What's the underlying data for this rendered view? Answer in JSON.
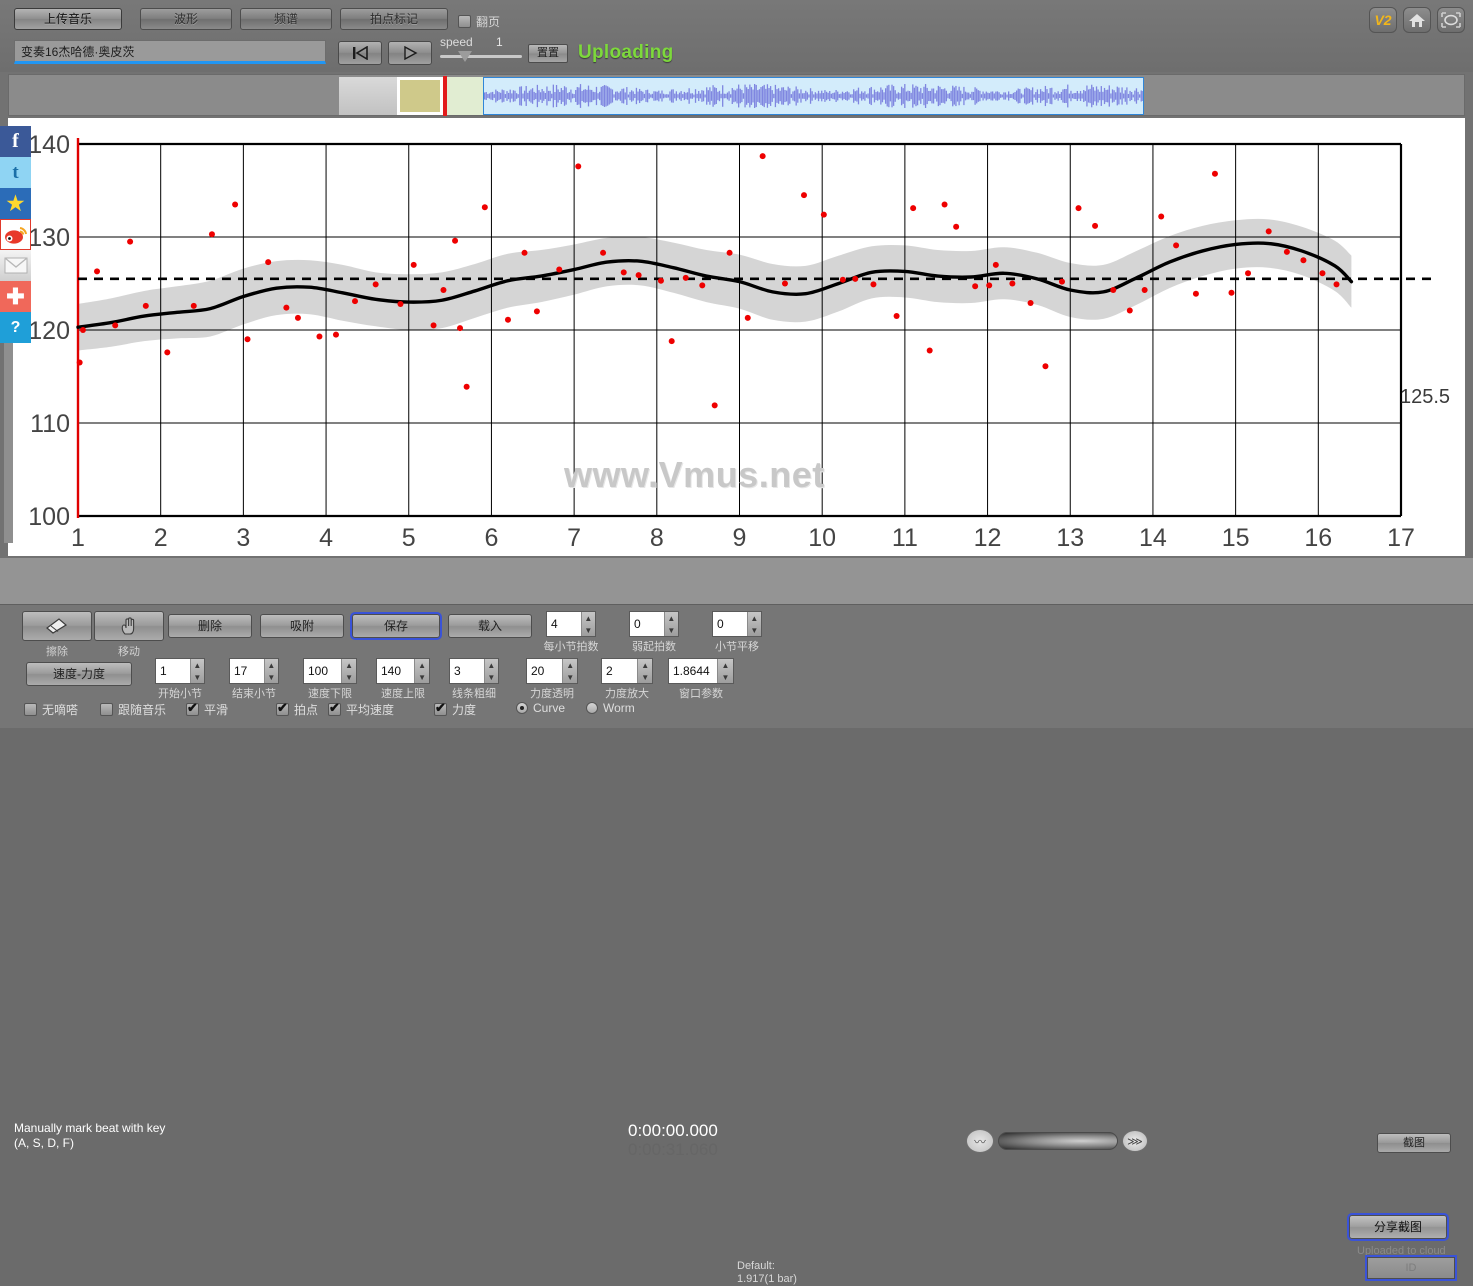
{
  "topbar": {
    "tabs": [
      {
        "label": "上传音乐",
        "active": true
      },
      {
        "label": "波形",
        "active": false
      },
      {
        "label": "频谱",
        "active": false
      },
      {
        "label": "拍点标记",
        "active": false
      }
    ],
    "page_turn_checkbox": {
      "label": "翻页",
      "checked": false
    },
    "title_field": {
      "value": "变奏16杰哈德·奥皮茨",
      "placeholder": ""
    },
    "prev_icon": "skip-to-start-icon",
    "play_icon": "play-icon",
    "speed_label": "speed",
    "speed_value": "1",
    "reset_label": "置置",
    "status": "Uploading",
    "right_icons": [
      {
        "name": "v2-badge",
        "label": "V2"
      },
      {
        "name": "home-icon",
        "label": "⌂"
      },
      {
        "name": "resize-icon",
        "label": "⛶"
      }
    ]
  },
  "social_rail": [
    {
      "name": "facebook-icon",
      "glyph": "f"
    },
    {
      "name": "twitter-icon",
      "glyph": "t"
    },
    {
      "name": "qzone-icon",
      "glyph": "★"
    },
    {
      "name": "weibo-icon",
      "glyph": "❝"
    },
    {
      "name": "email-icon",
      "glyph": "✉"
    },
    {
      "name": "more-share-icon",
      "glyph": "✚"
    },
    {
      "name": "help-icon",
      "glyph": "?"
    }
  ],
  "chart_data": {
    "type": "line",
    "title": "",
    "xlabel": "",
    "ylabel": "",
    "xlim": [
      1,
      17
    ],
    "ylim": [
      100,
      140
    ],
    "yticks": [
      100,
      110,
      120,
      130,
      140
    ],
    "xticks": [
      1,
      2,
      3,
      4,
      5,
      6,
      7,
      8,
      9,
      10,
      11,
      12,
      13,
      14,
      15,
      16,
      17
    ],
    "grid": true,
    "watermark": "www.Vmus.net",
    "average_line": {
      "value": 125.5,
      "label": "125.5",
      "style": "dashed"
    },
    "series": [
      {
        "name": "smoothed tempo curve",
        "type": "line",
        "color": "#000000",
        "x": [
          1.0,
          1.4,
          1.8,
          2.2,
          2.6,
          3.0,
          3.4,
          3.8,
          4.2,
          4.6,
          5.0,
          5.4,
          5.8,
          6.2,
          6.6,
          7.0,
          7.4,
          7.8,
          8.2,
          8.6,
          9.0,
          9.4,
          9.8,
          10.2,
          10.6,
          11.0,
          11.4,
          11.8,
          12.2,
          12.6,
          13.0,
          13.4,
          13.8,
          14.2,
          14.6,
          15.0,
          15.4,
          15.8,
          16.2,
          16.4
        ],
        "y": [
          120.3,
          120.8,
          121.5,
          121.9,
          122.3,
          123.6,
          124.5,
          124.6,
          124.0,
          123.3,
          123.0,
          123.2,
          124.2,
          125.3,
          125.8,
          126.5,
          127.3,
          127.4,
          126.7,
          125.8,
          125.2,
          124.1,
          123.9,
          125.0,
          126.2,
          126.3,
          125.8,
          125.7,
          126.1,
          125.5,
          124.3,
          124.1,
          125.6,
          127.3,
          128.5,
          129.2,
          129.3,
          128.5,
          126.9,
          125.2
        ]
      },
      {
        "name": "confidence band",
        "type": "area",
        "color": "#cccccc",
        "x": [
          1.0,
          1.4,
          1.8,
          2.2,
          2.6,
          3.0,
          3.4,
          3.8,
          4.2,
          4.6,
          5.0,
          5.4,
          5.8,
          6.2,
          6.6,
          7.0,
          7.4,
          7.8,
          8.2,
          8.6,
          9.0,
          9.4,
          9.8,
          10.2,
          10.6,
          11.0,
          11.4,
          11.8,
          12.2,
          12.6,
          13.0,
          13.4,
          13.8,
          14.2,
          14.6,
          15.0,
          15.4,
          15.8,
          16.2,
          16.4
        ],
        "upper": [
          122.8,
          123.4,
          124.2,
          124.7,
          125.3,
          126.6,
          127.4,
          127.5,
          127.0,
          126.2,
          126.0,
          126.2,
          127.1,
          128.2,
          128.6,
          129.2,
          129.9,
          130.0,
          129.4,
          128.6,
          128.1,
          127.1,
          126.9,
          128.0,
          129.0,
          129.1,
          128.6,
          128.5,
          128.9,
          128.3,
          127.2,
          127.0,
          128.5,
          130.1,
          131.2,
          131.8,
          131.9,
          131.1,
          129.6,
          128.0
        ],
        "lower": [
          117.8,
          118.2,
          118.8,
          119.1,
          119.3,
          120.6,
          121.6,
          121.7,
          121.0,
          120.4,
          120.0,
          120.2,
          121.3,
          122.4,
          123.0,
          123.8,
          124.7,
          124.8,
          124.0,
          123.0,
          122.3,
          121.1,
          120.9,
          122.0,
          123.4,
          123.5,
          123.0,
          122.9,
          123.3,
          122.7,
          121.4,
          121.2,
          122.7,
          124.5,
          125.8,
          126.6,
          126.7,
          125.9,
          124.2,
          122.4
        ]
      },
      {
        "name": "beat tempo points",
        "type": "scatter",
        "color": "#ee0000",
        "points": [
          [
            1.02,
            116.5
          ],
          [
            1.06,
            120.0
          ],
          [
            1.23,
            126.3
          ],
          [
            1.45,
            120.5
          ],
          [
            1.63,
            129.5
          ],
          [
            1.82,
            122.6
          ],
          [
            2.08,
            117.6
          ],
          [
            2.4,
            122.6
          ],
          [
            2.62,
            130.3
          ],
          [
            2.9,
            133.5
          ],
          [
            3.05,
            119.0
          ],
          [
            3.3,
            127.3
          ],
          [
            3.52,
            122.4
          ],
          [
            3.66,
            121.3
          ],
          [
            3.92,
            119.3
          ],
          [
            4.12,
            119.5
          ],
          [
            4.35,
            123.1
          ],
          [
            4.6,
            124.9
          ],
          [
            4.9,
            122.8
          ],
          [
            5.06,
            127.0
          ],
          [
            5.3,
            120.5
          ],
          [
            5.42,
            124.3
          ],
          [
            5.56,
            129.6
          ],
          [
            5.62,
            120.2
          ],
          [
            5.7,
            113.9
          ],
          [
            5.92,
            133.2
          ],
          [
            6.2,
            121.1
          ],
          [
            6.4,
            128.3
          ],
          [
            6.55,
            122.0
          ],
          [
            6.82,
            126.5
          ],
          [
            7.05,
            137.6
          ],
          [
            7.35,
            128.3
          ],
          [
            7.6,
            126.2
          ],
          [
            7.78,
            125.9
          ],
          [
            8.05,
            125.3
          ],
          [
            8.18,
            118.8
          ],
          [
            8.35,
            125.6
          ],
          [
            8.55,
            124.8
          ],
          [
            8.7,
            111.9
          ],
          [
            8.88,
            128.3
          ],
          [
            9.1,
            121.3
          ],
          [
            9.28,
            138.7
          ],
          [
            9.55,
            125.0
          ],
          [
            9.78,
            134.5
          ],
          [
            10.02,
            132.4
          ],
          [
            10.25,
            125.4
          ],
          [
            10.4,
            125.5
          ],
          [
            10.62,
            124.9
          ],
          [
            10.9,
            121.5
          ],
          [
            11.1,
            133.1
          ],
          [
            11.3,
            117.8
          ],
          [
            11.48,
            133.5
          ],
          [
            11.62,
            131.1
          ],
          [
            11.85,
            124.7
          ],
          [
            12.02,
            124.8
          ],
          [
            12.1,
            127.0
          ],
          [
            12.3,
            125.0
          ],
          [
            12.52,
            122.9
          ],
          [
            12.7,
            116.1
          ],
          [
            12.9,
            125.2
          ],
          [
            13.1,
            133.1
          ],
          [
            13.3,
            131.2
          ],
          [
            13.52,
            124.3
          ],
          [
            13.72,
            122.1
          ],
          [
            13.9,
            124.3
          ],
          [
            14.1,
            132.2
          ],
          [
            14.28,
            129.1
          ],
          [
            14.52,
            123.9
          ],
          [
            14.75,
            136.8
          ],
          [
            14.95,
            124.0
          ],
          [
            15.15,
            126.1
          ],
          [
            15.4,
            130.6
          ],
          [
            15.62,
            128.4
          ],
          [
            15.82,
            127.5
          ],
          [
            16.05,
            126.1
          ],
          [
            16.22,
            124.9
          ]
        ]
      }
    ]
  },
  "mid": {
    "hint_line1": "Manually mark beat with key",
    "hint_line2": "(A, S, D, F)",
    "time_current": "0:00:00.000",
    "time_total": "0:00:31.060",
    "screenshot_label": "截图"
  },
  "bottom": {
    "tool_buttons": [
      {
        "name": "erase-tool",
        "icon": "eraser-icon",
        "caption": "擦除",
        "selected": false
      },
      {
        "name": "move-tool",
        "icon": "hand-icon",
        "caption": "移动",
        "selected": false
      }
    ],
    "action_buttons": [
      {
        "label": "删除",
        "selected": false
      },
      {
        "label": "吸附",
        "selected": false
      },
      {
        "label": "保存",
        "selected": true
      },
      {
        "label": "载入",
        "selected": false
      }
    ],
    "tempo_dynamics_button": "速度-力度",
    "spinners_row1": [
      {
        "label": "每小节拍数",
        "value": "4"
      },
      {
        "label": "弱起拍数",
        "value": "0"
      },
      {
        "label": "小节平移",
        "value": "0"
      }
    ],
    "spinners_row2": [
      {
        "label": "开始小节",
        "value": "1"
      },
      {
        "label": "结束小节",
        "value": "17"
      },
      {
        "label": "速度下限",
        "value": "100"
      },
      {
        "label": "速度上限",
        "value": "140"
      },
      {
        "label": "线条粗细",
        "value": "3"
      },
      {
        "label": "力度透明",
        "value": "20"
      },
      {
        "label": "力度放大",
        "value": "2"
      },
      {
        "label": "窗口参数",
        "value": "1.8644"
      }
    ],
    "default_note_line1": "Default:",
    "default_note_line2": "1.917(1 bar)",
    "checkboxes": [
      {
        "label": "无嘀嗒",
        "checked": false
      },
      {
        "label": "跟随音乐",
        "checked": false
      },
      {
        "label": "平滑",
        "checked": true
      },
      {
        "label": "拍点",
        "checked": true
      },
      {
        "label": "平均速度",
        "checked": true
      },
      {
        "label": "力度",
        "checked": true
      }
    ],
    "radios": [
      {
        "label": "Curve",
        "selected": true
      },
      {
        "label": "Worm",
        "selected": false
      }
    ],
    "share_button": "分享截图",
    "uploaded_text": "Uploaded to cloud",
    "id_button": "ID"
  }
}
